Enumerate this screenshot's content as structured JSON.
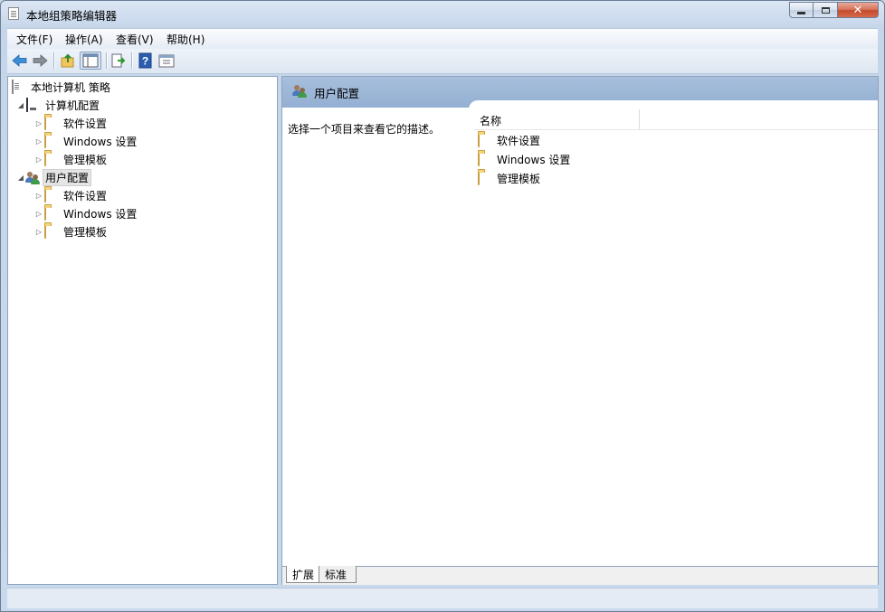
{
  "window": {
    "title": "本地组策略编辑器",
    "caption": {
      "minimize_icon": "minimize-icon",
      "maximize_icon": "maximize-icon",
      "close_icon": "close-icon",
      "close_glyph": "✕"
    }
  },
  "menu": [
    "文件(F)",
    "操作(A)",
    "查看(V)",
    "帮助(H)"
  ],
  "toolbar": {
    "icons": [
      "back-arrow-icon",
      "forward-arrow-icon",
      "up-folder-icon",
      "show-hide-tree-icon",
      "export-list-icon",
      "help-icon",
      "properties-icon"
    ],
    "help_glyph": "?"
  },
  "tree": {
    "root": "本地计算机 策略",
    "computer": {
      "label": "计算机配置",
      "children": [
        "软件设置",
        "Windows 设置",
        "管理模板"
      ]
    },
    "user": {
      "label": "用户配置",
      "children": [
        "软件设置",
        "Windows 设置",
        "管理模板"
      ]
    },
    "expanded_glyph": "◢",
    "collapsed_glyph": "▷"
  },
  "details": {
    "header_title": "用户配置",
    "description": "选择一个项目来查看它的描述。",
    "column_name": "名称",
    "items": [
      "软件设置",
      "Windows 设置",
      "管理模板"
    ]
  },
  "tabs": [
    "扩展",
    "标准"
  ],
  "colors": {
    "header_blue": "#9bb5d6",
    "folder_yellow": "#f5d57a",
    "close_red": "#c44a2d"
  }
}
